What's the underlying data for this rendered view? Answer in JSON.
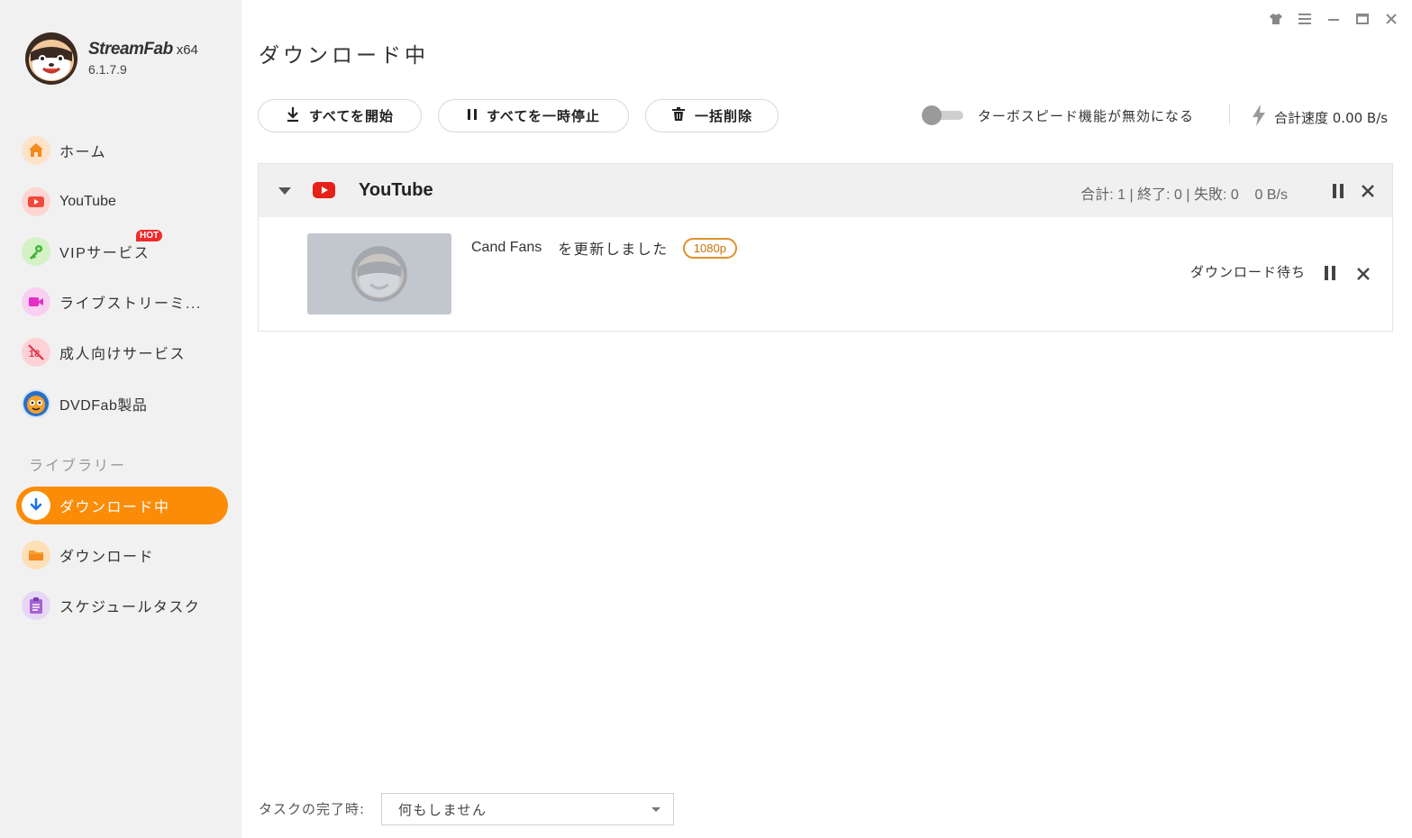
{
  "app": {
    "name": "StreamFab",
    "arch": "x64",
    "version": "6.1.7.9"
  },
  "sidebar": {
    "items": [
      {
        "id": "home",
        "label": "ホーム",
        "icon": "home-icon"
      },
      {
        "id": "youtube",
        "label": "YouTube",
        "icon": "youtube-icon"
      },
      {
        "id": "vip",
        "label": "VIPサービス",
        "icon": "key-icon",
        "badge": "HOT"
      },
      {
        "id": "live",
        "label": "ライブストリーミ...",
        "icon": "video-camera-icon"
      },
      {
        "id": "adult",
        "label": "成人向けサービス",
        "icon": "adult-restricted-icon"
      },
      {
        "id": "dvdfab",
        "label": "DVDFab製品",
        "icon": "dvdfab-logo-icon"
      }
    ],
    "library_label": "ライブラリー",
    "library_items": [
      {
        "id": "downloading",
        "label": "ダウンロード中",
        "icon": "download-arrow-icon",
        "active": true
      },
      {
        "id": "downloaded",
        "label": "ダウンロード",
        "icon": "folder-icon"
      },
      {
        "id": "schedule",
        "label": "スケジュールタスク",
        "icon": "clipboard-icon"
      }
    ]
  },
  "header": {
    "title": "ダウンロード中"
  },
  "toolbar": {
    "start_all": "すべてを開始",
    "pause_all": "すべてを一時停止",
    "delete_all": "一括削除",
    "turbo_label": "ターボスピード機能が無効になる",
    "turbo_enabled": false,
    "speed_label": "合計速度 0.00 B/s"
  },
  "group": {
    "title": "YouTube",
    "stats": "合計: 1 | 終了: 0 | 失敗: 0    0 B/s",
    "tasks": [
      {
        "title": "Cand Fans",
        "subtitle": "を更新しました",
        "resolution": "1080p",
        "status": "ダウンロード待ち"
      }
    ]
  },
  "footer": {
    "label": "タスクの完了時:",
    "selected": "何もしません"
  },
  "colors": {
    "accent": "#fb8c07",
    "youtube_red": "#e62117",
    "sidebar_bg": "#f1f1f1"
  }
}
